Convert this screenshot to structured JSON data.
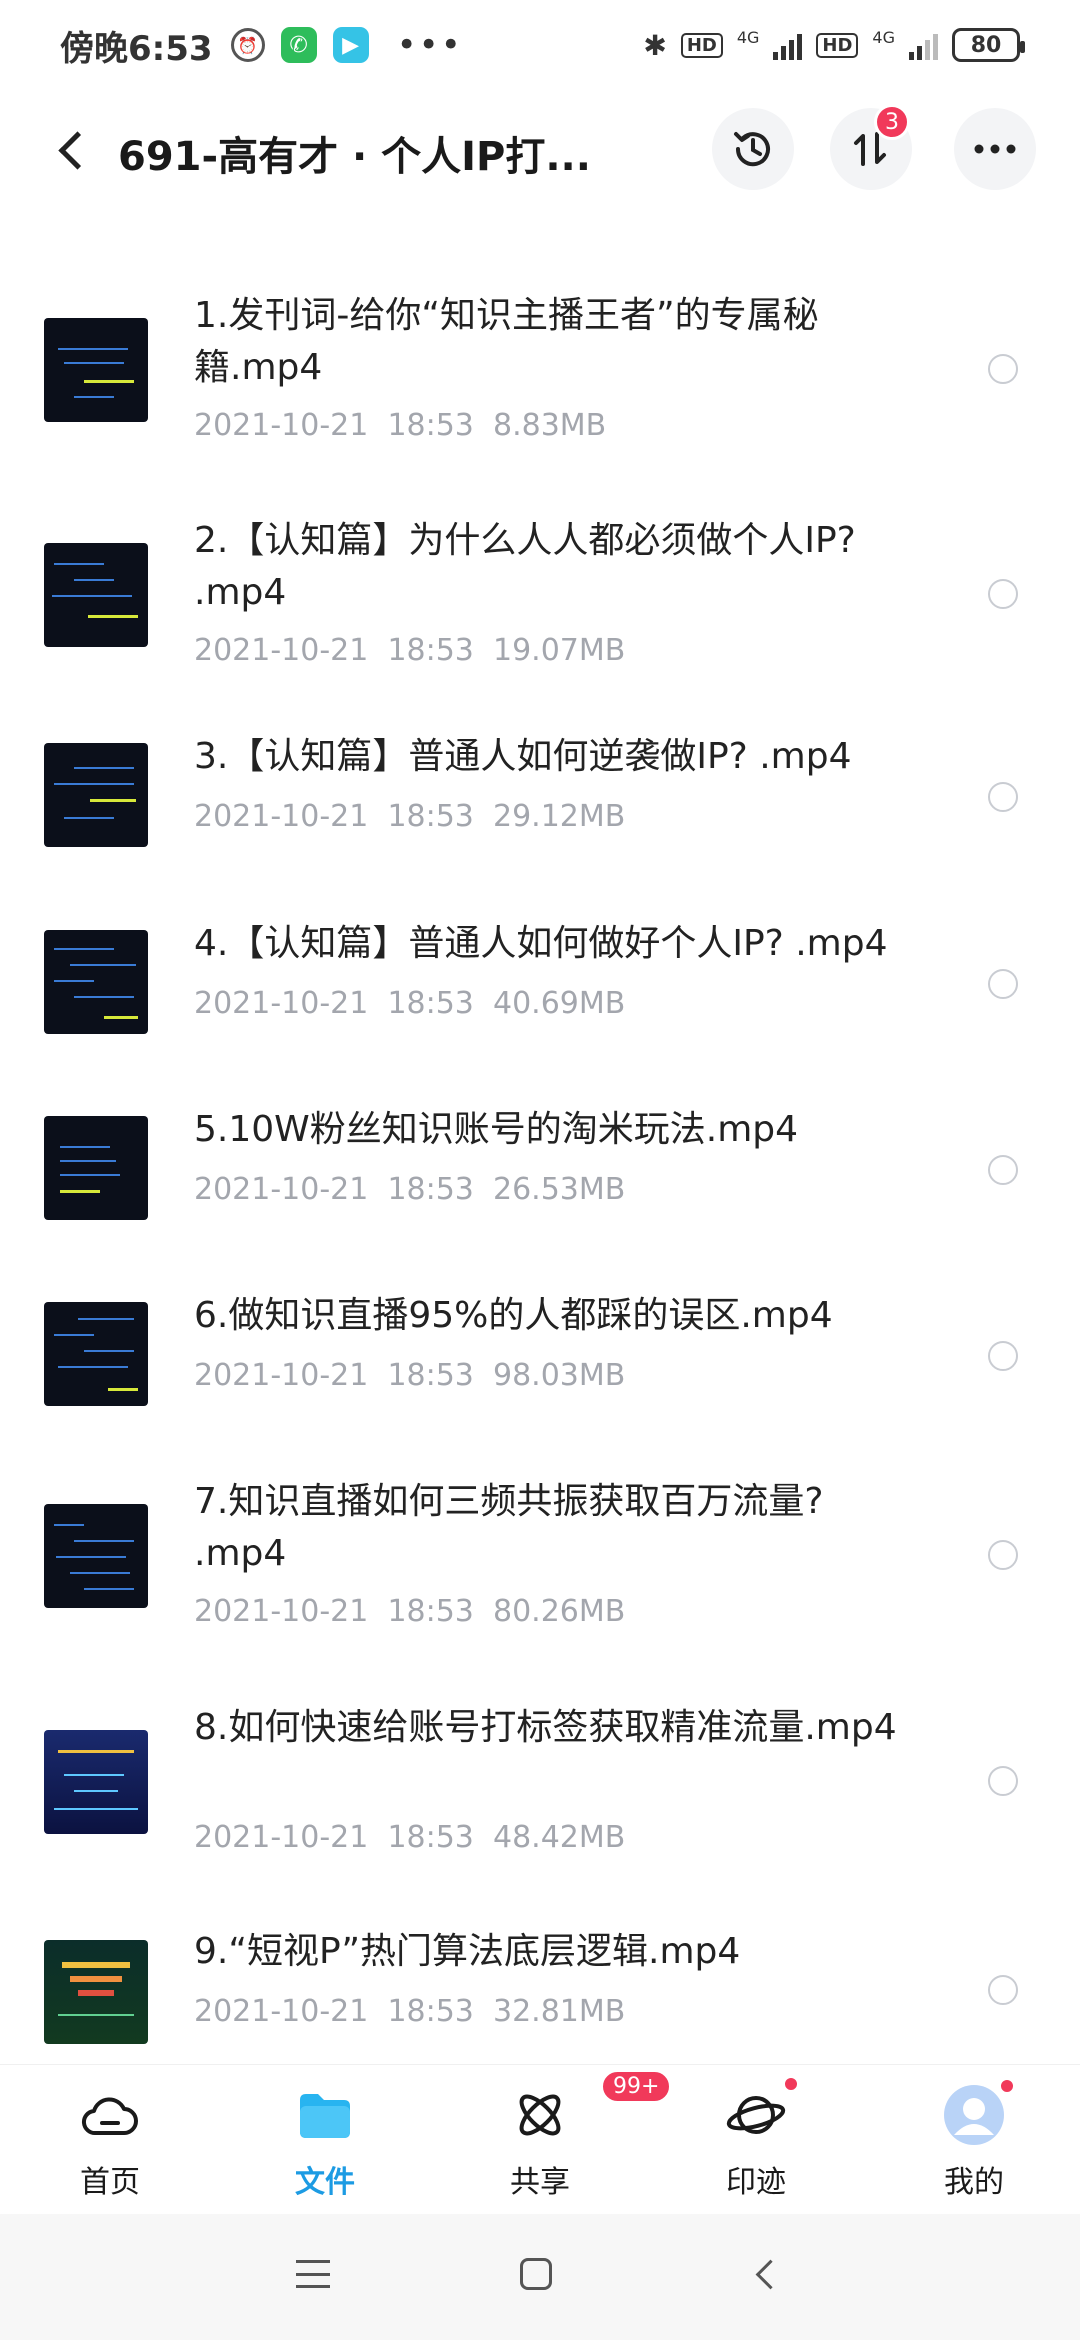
{
  "status_bar": {
    "time": "傍晚6:53",
    "more": "•••",
    "network_hd_1": "HD",
    "network_4g_1": "4G",
    "network_hd_2": "HD",
    "network_4g_2": "4G",
    "battery": "80"
  },
  "header": {
    "title": "691-高有才 · 个人IP打...",
    "transfer_badge": "3"
  },
  "files": [
    {
      "name": "1.发刊词-给你“知识主播王者”的专属秘籍.mp4",
      "date": "2021-10-21",
      "time": "18:53",
      "size": "8.83MB"
    },
    {
      "name": "2.【认知篇】为什么人人都必须做个人IP? .mp4",
      "date": "2021-10-21",
      "time": "18:53",
      "size": "19.07MB"
    },
    {
      "name": "3.【认知篇】普通人如何逆袭做IP? .mp4",
      "date": "2021-10-21",
      "time": "18:53",
      "size": "29.12MB"
    },
    {
      "name": "4.【认知篇】普通人如何做好个人IP? .mp4",
      "date": "2021-10-21",
      "time": "18:53",
      "size": "40.69MB"
    },
    {
      "name": "5.10W粉丝知识账号的淘米玩法.mp4",
      "date": "2021-10-21",
      "time": "18:53",
      "size": "26.53MB"
    },
    {
      "name": "6.做知识直播95%的人都踩的误区.mp4",
      "date": "2021-10-21",
      "time": "18:53",
      "size": "98.03MB"
    },
    {
      "name": "7.知识直播如何三频共振获取百万流量? .mp4",
      "date": "2021-10-21",
      "time": "18:53",
      "size": "80.26MB"
    },
    {
      "name": "8.如何快速给账号打标签获取精准流量.mp4",
      "date": "2021-10-21",
      "time": "18:53",
      "size": "48.42MB"
    },
    {
      "name": "9.“短视P”热门算法底层逻辑.mp4",
      "date": "2021-10-21",
      "time": "18:53",
      "size": "32.81MB"
    }
  ],
  "bottom_nav": {
    "home": "首页",
    "files": "文件",
    "share": "共享",
    "share_badge": "99+",
    "trace": "印迹",
    "me": "我的"
  },
  "colors": {
    "accent": "#1c9be3",
    "badge": "#f1395a",
    "meta_text": "#a3a6ad"
  },
  "icons": [
    "alarm-icon",
    "phone-icon",
    "play-icon",
    "bluetooth-icon",
    "signal-icon",
    "battery-icon",
    "back-icon",
    "history-icon",
    "transfer-icon",
    "more-icon",
    "cloud-icon",
    "folder-icon",
    "share-atom-icon",
    "planet-icon",
    "avatar-icon"
  ]
}
